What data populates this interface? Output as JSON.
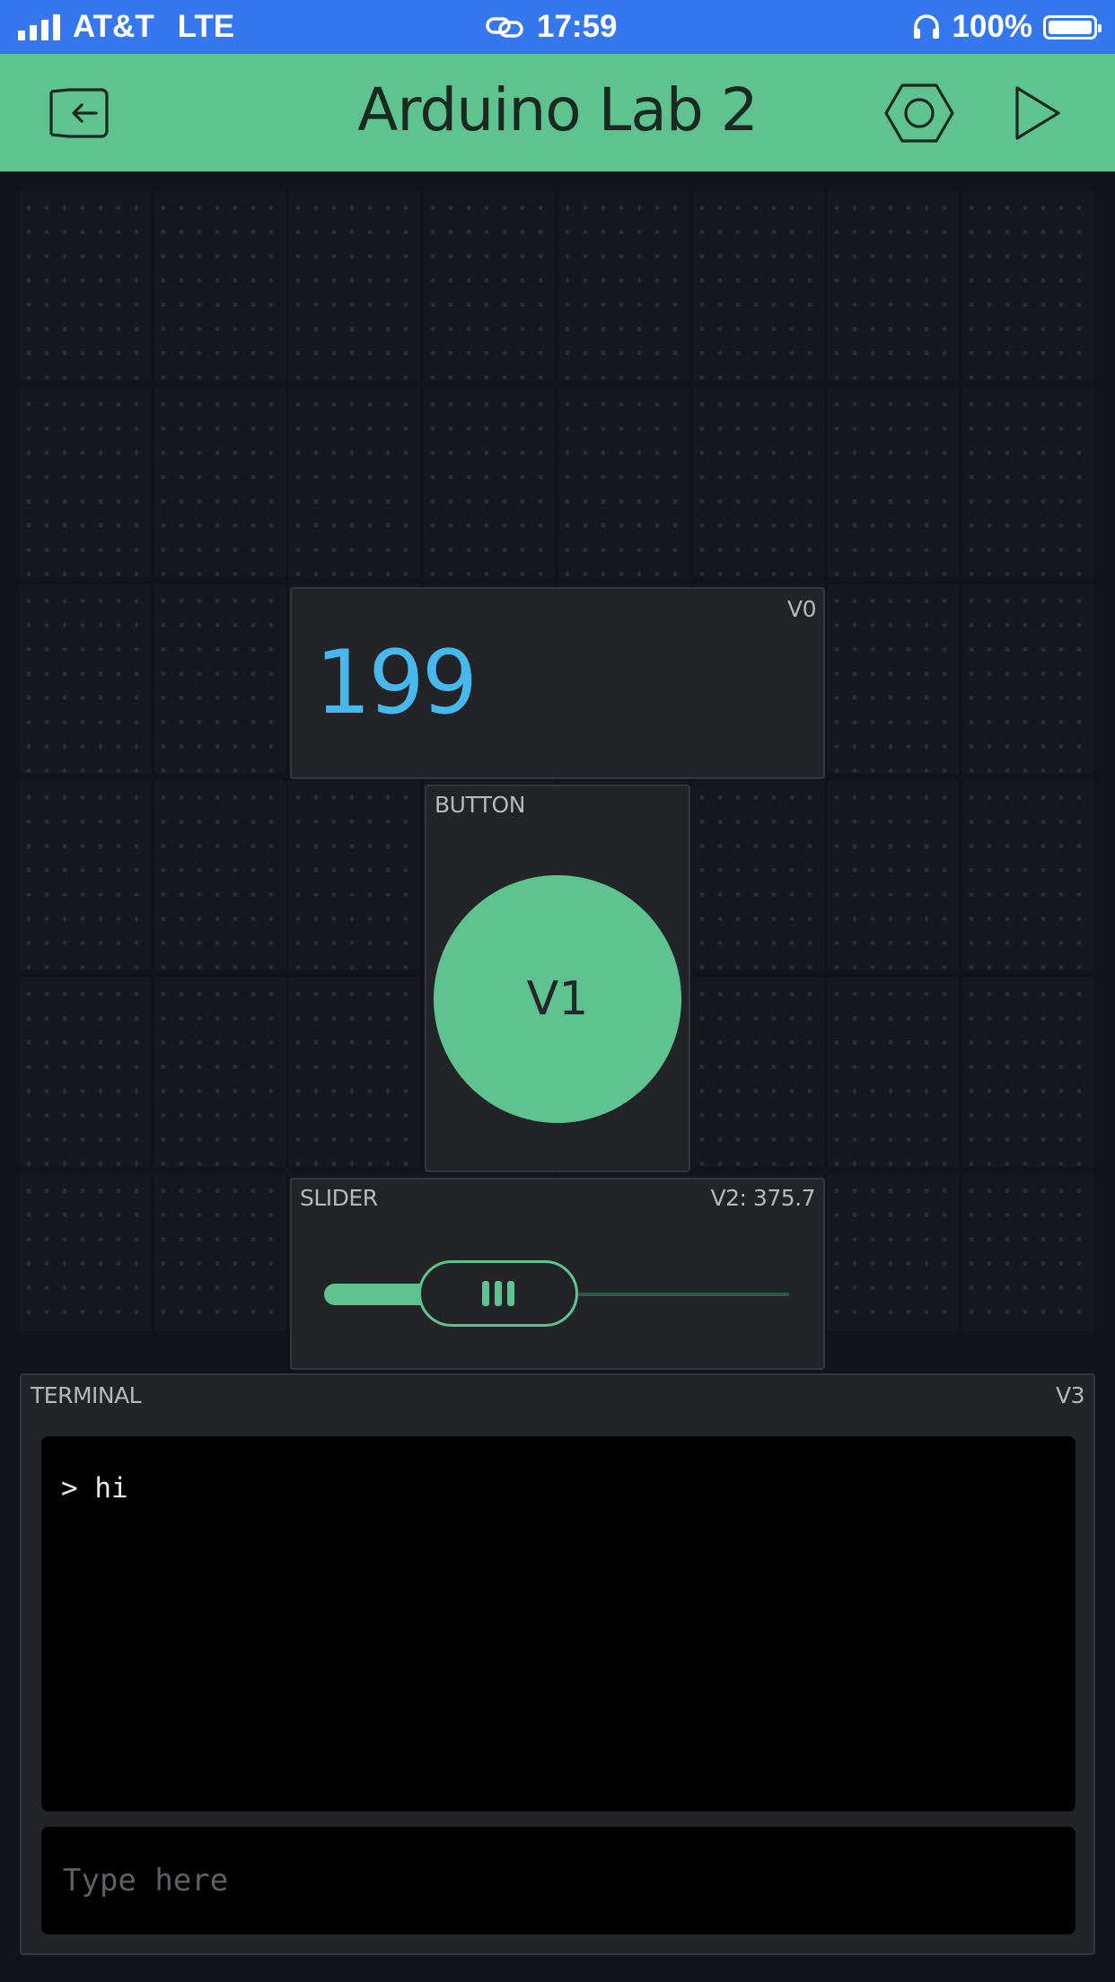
{
  "status_bar": {
    "carrier": "AT&T",
    "network": "LTE",
    "time": "17:59",
    "battery": "100%",
    "icons": [
      "signal-icon",
      "link-icon",
      "headphones-icon",
      "battery-icon"
    ]
  },
  "header": {
    "title": "Arduino Lab 2",
    "icons": [
      "exit-icon",
      "settings-hexagon-icon",
      "play-icon"
    ],
    "background": "#5fc38f"
  },
  "widgets": {
    "display": {
      "pin": "V0",
      "value": "199",
      "value_color": "#48b8ec"
    },
    "button": {
      "label": "BUTTON",
      "text": "V1",
      "color": "#5fc38f"
    },
    "slider": {
      "label": "SLIDER",
      "value_text": "V2: 375.7",
      "level_fraction": 0.37,
      "color": "#5fc38f"
    },
    "terminal": {
      "label": "TERMINAL",
      "pin": "V3",
      "lines": [
        "> hi"
      ],
      "input_placeholder": "Type here"
    }
  }
}
